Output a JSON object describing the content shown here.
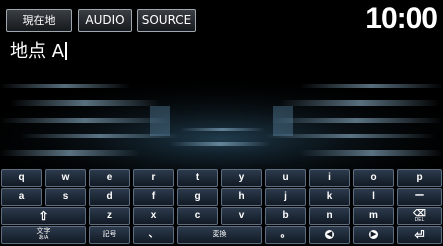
{
  "header": {
    "current_location_label": "現在地",
    "audio_label": "AUDIO",
    "source_label": "SOURCE",
    "clock": "10:00"
  },
  "input": {
    "text": "地点 A"
  },
  "keyboard": {
    "row1": [
      "q",
      "w",
      "e",
      "r",
      "t",
      "y",
      "u",
      "i",
      "o",
      "p"
    ],
    "row2": [
      "a",
      "s",
      "d",
      "f",
      "g",
      "h",
      "j",
      "k",
      "l",
      "ー"
    ],
    "row3": [
      "z",
      "x",
      "c",
      "v",
      "b",
      "n",
      "m"
    ],
    "shift_glyph": "⇧",
    "delete_label": "DEL",
    "char_type_label": "文字",
    "char_type_sub": "あ/A",
    "symbols_label": "記号",
    "comma_label": "、",
    "convert_label": "変換",
    "period_label": "。",
    "left_glyph": "◀",
    "right_glyph": "▶",
    "enter_glyph": "⏎"
  }
}
